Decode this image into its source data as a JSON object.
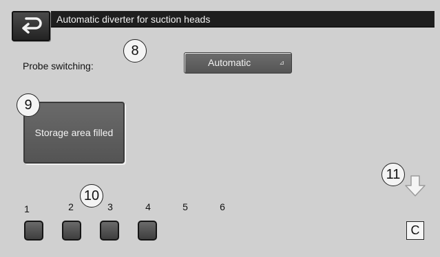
{
  "header": {
    "title": "Automatic diverter for suction heads"
  },
  "probe_switching": {
    "label": "Probe switching:",
    "selected_value": "Automatic",
    "dropdown_glyph": "⊿"
  },
  "storage": {
    "button_label": "Storage area filled"
  },
  "suction_heads": [
    {
      "number": "1"
    },
    {
      "number": "2"
    },
    {
      "number": "3"
    },
    {
      "number": "4"
    },
    {
      "number": "5"
    },
    {
      "number": "6"
    }
  ],
  "callouts": {
    "c8": "8",
    "c9": "9",
    "c10": "10",
    "c11": "11"
  },
  "corner_button": {
    "label": "C"
  },
  "icons": {
    "back": "back-arrow-icon",
    "scroll_down": "down-arrow-icon"
  },
  "colors": {
    "background": "#d0d0d0",
    "title_bar": "#1e1e1e",
    "button_dark": "#5a5a5a"
  }
}
